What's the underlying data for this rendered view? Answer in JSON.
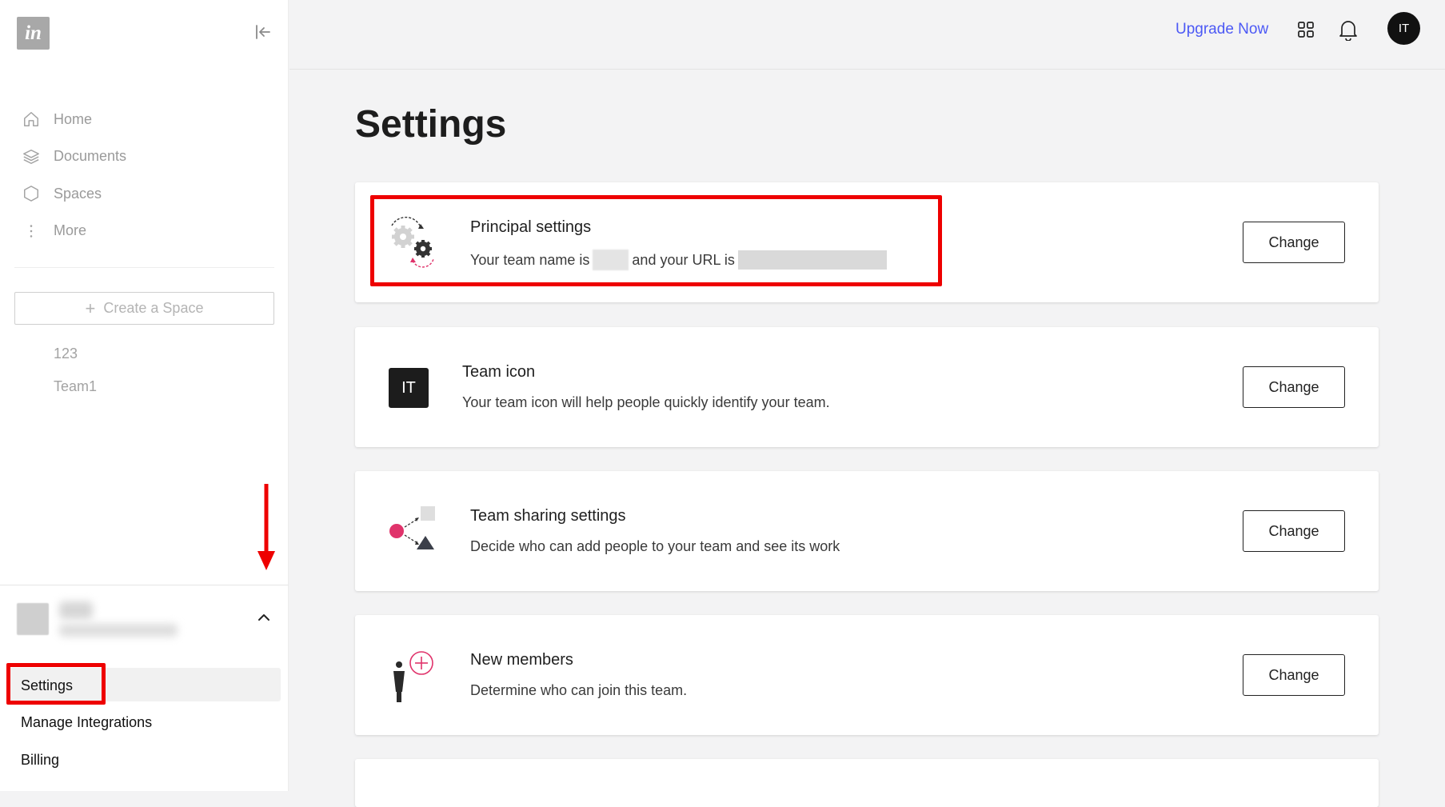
{
  "sidebar": {
    "logo_text": "in",
    "nav": [
      {
        "label": "Home",
        "icon": "home-icon"
      },
      {
        "label": "Documents",
        "icon": "layers-icon"
      },
      {
        "label": "Spaces",
        "icon": "hexagon-icon"
      },
      {
        "label": "More",
        "icon": "more-vertical-icon"
      }
    ],
    "create_space": "Create a Space",
    "spaces": [
      "123",
      "Team1"
    ],
    "menu": {
      "settings": "Settings",
      "manage_integrations": "Manage Integrations",
      "billing": "Billing"
    }
  },
  "header": {
    "upgrade": "Upgrade Now",
    "avatar_initials": "IT"
  },
  "main": {
    "title": "Settings",
    "cards": [
      {
        "title": "Principal settings",
        "desc_prefix": "Your team name is",
        "desc_middle": "and your URL is",
        "button": "Change"
      },
      {
        "title": "Team icon",
        "icon_text": "IT",
        "desc": "Your team icon will help people quickly identify your team.",
        "button": "Change"
      },
      {
        "title": "Team sharing settings",
        "desc": "Decide who can add people to your team and see its work",
        "button": "Change"
      },
      {
        "title": "New members",
        "desc": "Determine who can join this team.",
        "button": "Change"
      }
    ]
  },
  "colors": {
    "accent_link": "#4c59f5",
    "highlight_red": "#ee0000",
    "pink": "#e0336b"
  }
}
